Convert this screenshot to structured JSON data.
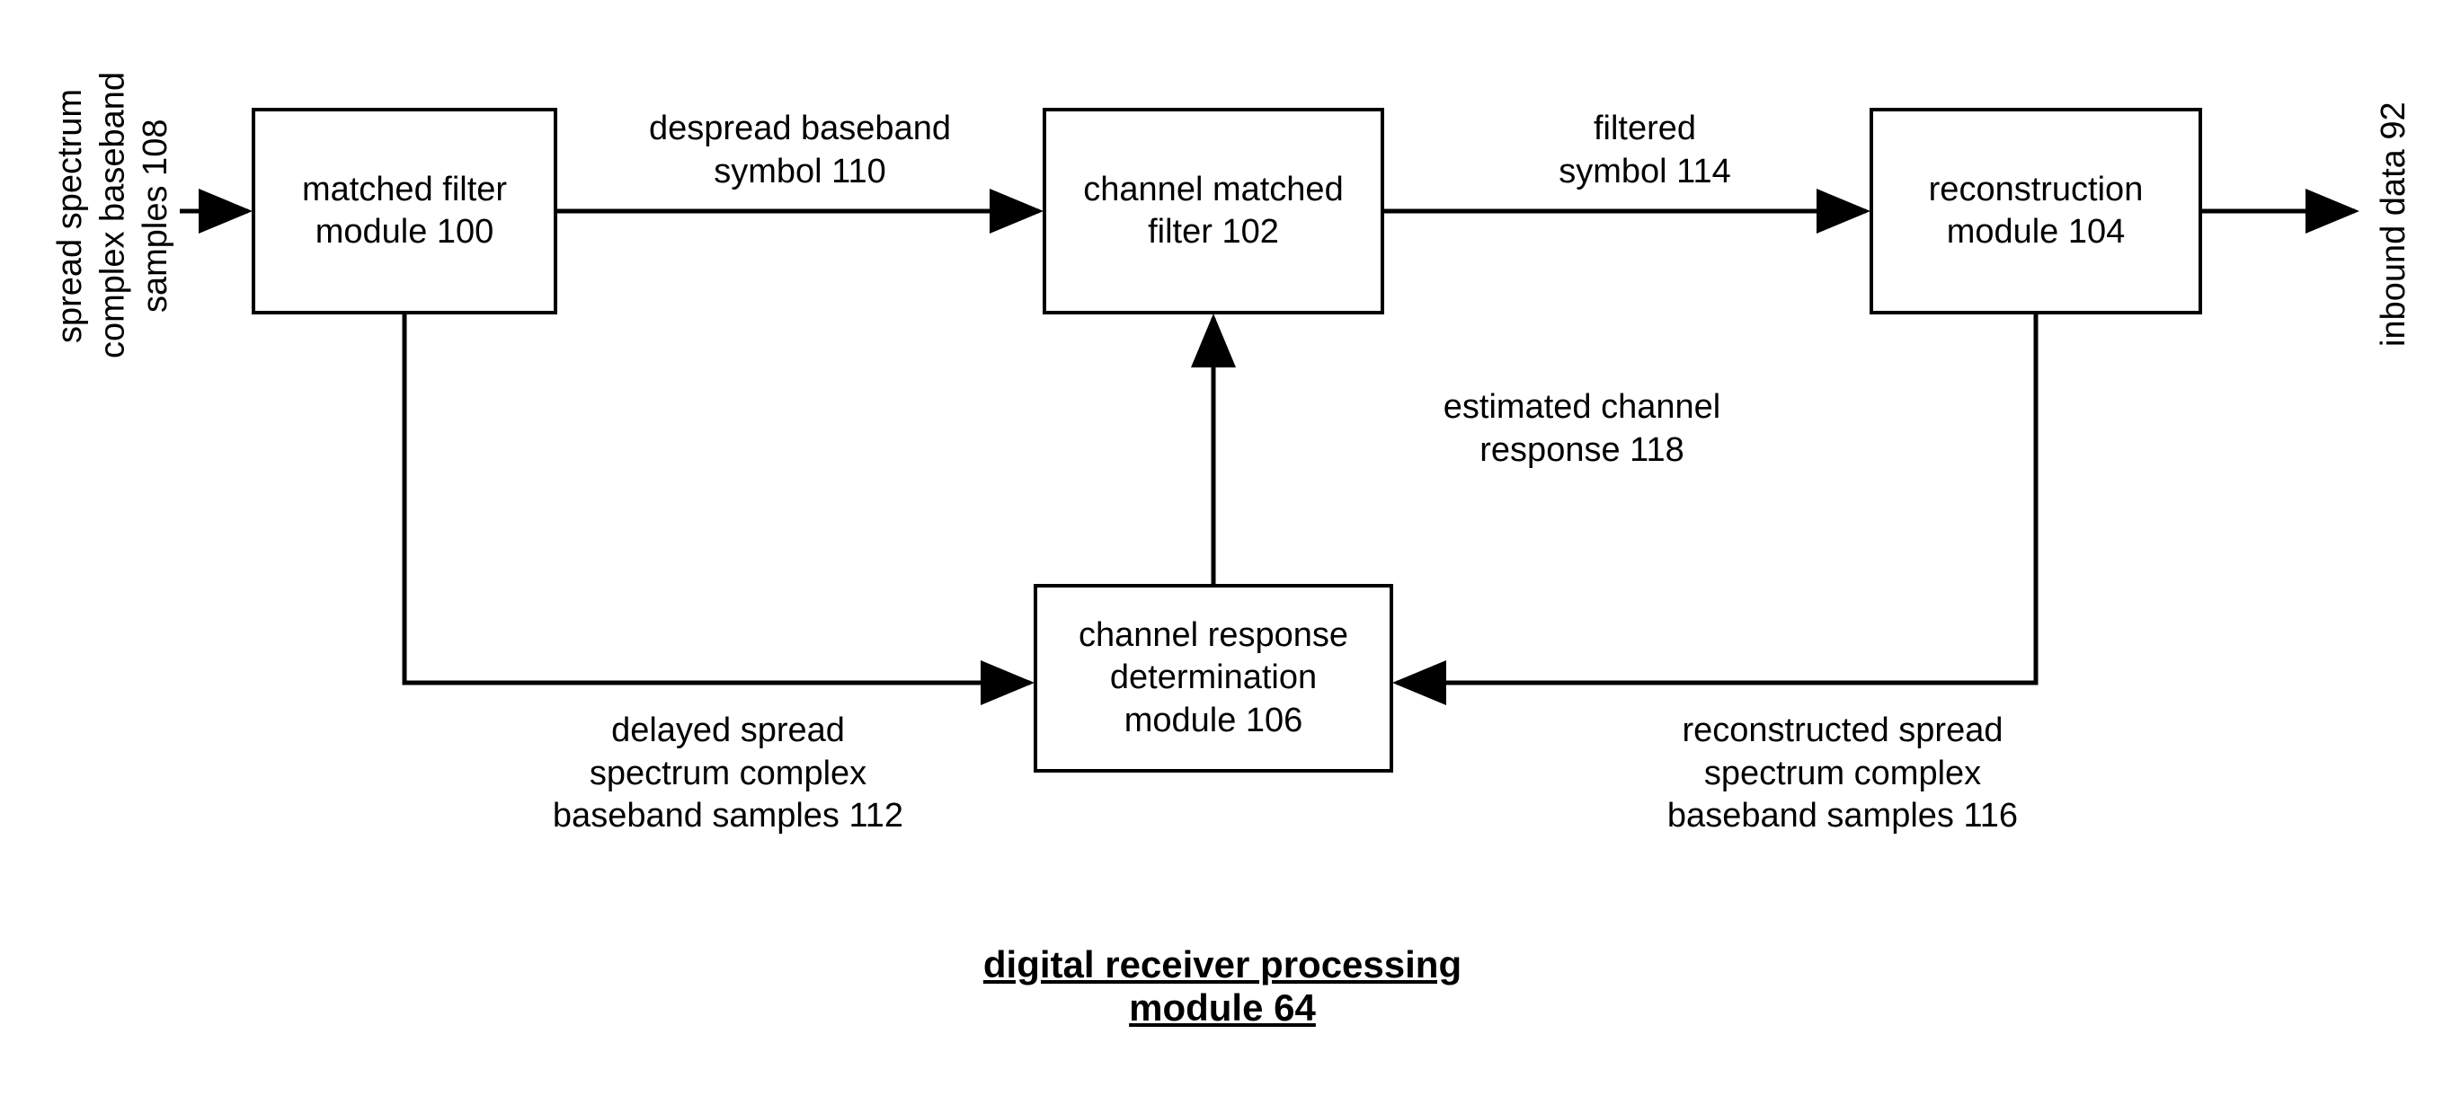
{
  "inputLabel": "spread spectrum\ncomplex baseband\nsamples 108",
  "outputLabel": "inbound data 92",
  "boxes": {
    "matchedFilter": "matched filter\nmodule 100",
    "channelMatchedFilter": "channel matched\nfilter 102",
    "reconstruction": "reconstruction\nmodule 104",
    "channelResponse": "channel response\ndetermination\nmodule 106"
  },
  "arrowLabels": {
    "despread": "despread baseband\nsymbol 110",
    "filtered": "filtered\nsymbol 114",
    "estimated": "estimated channel\nresponse 118",
    "delayed": "delayed spread\nspectrum complex\nbaseband samples 112",
    "reconstructed": "reconstructed spread\nspectrum complex\nbaseband samples 116"
  },
  "title": "digital receiver processing\nmodule 64"
}
